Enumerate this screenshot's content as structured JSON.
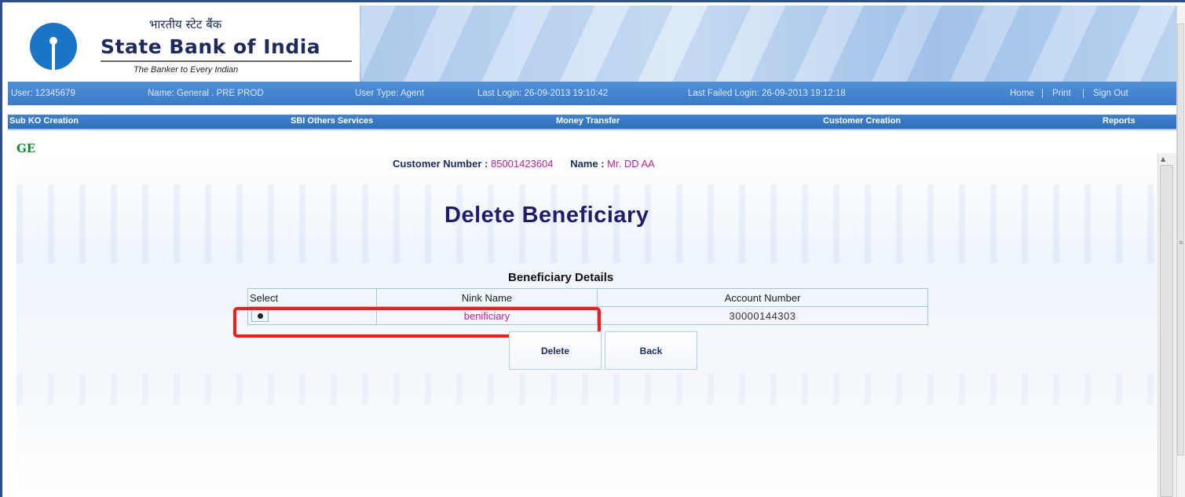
{
  "header": {
    "hindi_name": "भारतीय स्टेट बैंक",
    "bank_name": "State Bank of India",
    "tagline": "The Banker to Every Indian"
  },
  "userbar": {
    "user": "User: 12345679",
    "name": "Name: General . PRE PROD",
    "user_type": "User Type: Agent",
    "last_login": "Last Login: 26-09-2013 19:10:42",
    "last_failed_login": "Last Failed Login: 26-09-2013 19:12:18",
    "links": [
      "Home",
      "Print",
      "Sign Out"
    ],
    "separator": "|"
  },
  "nav": {
    "items": [
      "Sub KO Creation",
      "SBI Others Services",
      "Money Transfer",
      "Customer Creation",
      "Reports"
    ]
  },
  "partial_text": "GE",
  "customer": {
    "number_label": "Customer Number :",
    "number_value": "85001423604",
    "name_label": "Name :",
    "name_value": "Mr. DD AA"
  },
  "page_title": "Delete Beneficiary",
  "section_title": "Beneficiary Details",
  "table": {
    "headers": [
      "Select",
      "Nink Name",
      "Account Number"
    ],
    "rows": [
      {
        "selected": true,
        "nick_name": "benificiary",
        "account_number": "30000144303"
      }
    ]
  },
  "buttons": {
    "delete": "Delete",
    "back": "Back"
  },
  "colors": {
    "accent_blue": "#3a7cc9",
    "title_navy": "#1f1d6b",
    "value_magenta": "#c0209a",
    "highlight_red": "#ff1a1a",
    "partial_text_green": "#0d8a2f"
  },
  "icons": [
    "sbi-logo-icon",
    "radio-selected-icon",
    "scroll-up-icon"
  ]
}
